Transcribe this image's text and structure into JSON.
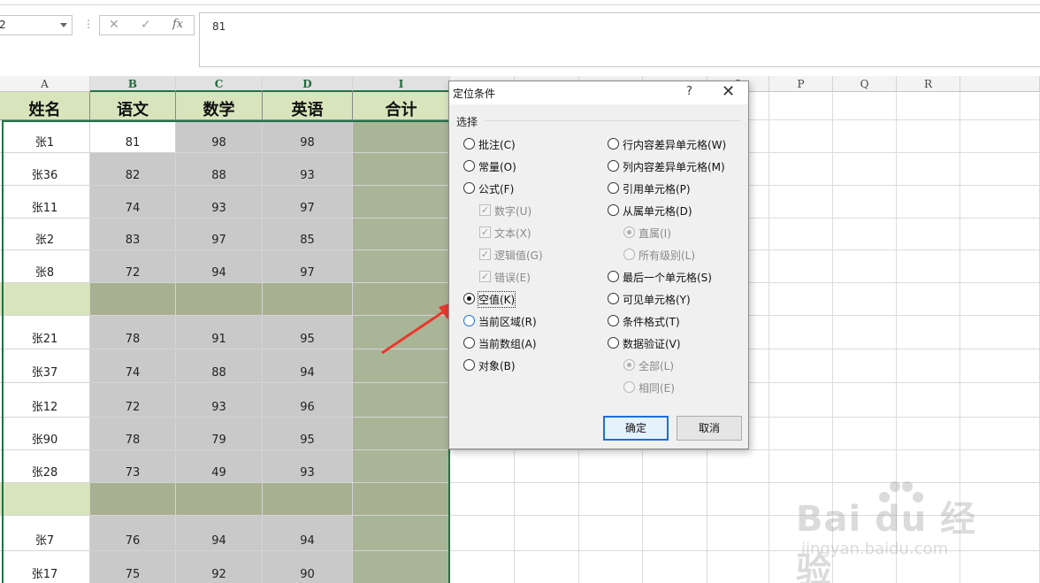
{
  "formula": {
    "namebox_value": "2",
    "cancel_icon": "✕",
    "enter_icon": "✓",
    "function_icon": "fx",
    "content": "81"
  },
  "columns": [
    {
      "letter": "A",
      "selected": false
    },
    {
      "letter": "B",
      "selected": true
    },
    {
      "letter": "C",
      "selected": true
    },
    {
      "letter": "D",
      "selected": true
    },
    {
      "letter": "I",
      "selected": true
    },
    {
      "letter": "",
      "selected": false
    },
    {
      "letter": "",
      "selected": false
    },
    {
      "letter": "",
      "selected": false
    },
    {
      "letter": "",
      "selected": false
    },
    {
      "letter": "O",
      "selected": false
    },
    {
      "letter": "P",
      "selected": false
    },
    {
      "letter": "Q",
      "selected": false
    },
    {
      "letter": "R",
      "selected": false
    }
  ],
  "table": {
    "headers": [
      "姓名",
      "语文",
      "数学",
      "英语",
      "合计"
    ],
    "rows": [
      {
        "name": "张1",
        "chinese": "81",
        "math": "98",
        "english": "98",
        "total": ""
      },
      {
        "name": "张36",
        "chinese": "82",
        "math": "88",
        "english": "93",
        "total": ""
      },
      {
        "name": "张11",
        "chinese": "74",
        "math": "93",
        "english": "97",
        "total": ""
      },
      {
        "name": "张2",
        "chinese": "83",
        "math": "97",
        "english": "85",
        "total": ""
      },
      {
        "name": "张8",
        "chinese": "72",
        "math": "94",
        "english": "97",
        "total": ""
      },
      {
        "name": "",
        "chinese": "",
        "math": "",
        "english": "",
        "total": ""
      },
      {
        "name": "张21",
        "chinese": "78",
        "math": "91",
        "english": "95",
        "total": ""
      },
      {
        "name": "张37",
        "chinese": "74",
        "math": "88",
        "english": "94",
        "total": ""
      },
      {
        "name": "张12",
        "chinese": "72",
        "math": "93",
        "english": "96",
        "total": ""
      },
      {
        "name": "张90",
        "chinese": "78",
        "math": "79",
        "english": "95",
        "total": ""
      },
      {
        "name": "张28",
        "chinese": "73",
        "math": "49",
        "english": "93",
        "total": ""
      },
      {
        "name": "",
        "chinese": "",
        "math": "",
        "english": "",
        "total": ""
      },
      {
        "name": "张7",
        "chinese": "76",
        "math": "94",
        "english": "94",
        "total": ""
      },
      {
        "name": "张17",
        "chinese": "75",
        "math": "92",
        "english": "90",
        "total": ""
      }
    ]
  },
  "dialog": {
    "title": "定位条件",
    "help": "?",
    "close": "✕",
    "group_label": "选择",
    "left_options": [
      {
        "label": "批注(C)",
        "kind": "radio",
        "checked": false,
        "disabled": false
      },
      {
        "label": "常量(O)",
        "kind": "radio",
        "checked": false,
        "disabled": false
      },
      {
        "label": "公式(F)",
        "kind": "radio",
        "checked": false,
        "disabled": false
      },
      {
        "label": "数字(U)",
        "kind": "check",
        "checked": true,
        "disabled": true
      },
      {
        "label": "文本(X)",
        "kind": "check",
        "checked": true,
        "disabled": true
      },
      {
        "label": "逻辑值(G)",
        "kind": "check",
        "checked": true,
        "disabled": true
      },
      {
        "label": "错误(E)",
        "kind": "check",
        "checked": true,
        "disabled": true
      },
      {
        "label": "空值(K)",
        "kind": "radio",
        "checked": true,
        "disabled": false
      },
      {
        "label": "当前区域(R)",
        "kind": "radio",
        "checked": false,
        "disabled": false
      },
      {
        "label": "当前数组(A)",
        "kind": "radio",
        "checked": false,
        "disabled": false
      },
      {
        "label": "对象(B)",
        "kind": "radio",
        "checked": false,
        "disabled": false
      }
    ],
    "right_options": [
      {
        "label": "行内容差异单元格(W)",
        "kind": "radio",
        "checked": false,
        "disabled": false
      },
      {
        "label": "列内容差异单元格(M)",
        "kind": "radio",
        "checked": false,
        "disabled": false
      },
      {
        "label": "引用单元格(P)",
        "kind": "radio",
        "checked": false,
        "disabled": false
      },
      {
        "label": "从属单元格(D)",
        "kind": "radio",
        "checked": false,
        "disabled": false
      },
      {
        "label": "直属(I)",
        "kind": "radio",
        "checked": true,
        "disabled": true
      },
      {
        "label": "所有级别(L)",
        "kind": "radio",
        "checked": false,
        "disabled": true
      },
      {
        "label": "最后一个单元格(S)",
        "kind": "radio",
        "checked": false,
        "disabled": false
      },
      {
        "label": "可见单元格(Y)",
        "kind": "radio",
        "checked": false,
        "disabled": false
      },
      {
        "label": "条件格式(T)",
        "kind": "radio",
        "checked": false,
        "disabled": false
      },
      {
        "label": "数据验证(V)",
        "kind": "radio",
        "checked": false,
        "disabled": false
      },
      {
        "label": "全部(L)",
        "kind": "radio",
        "checked": true,
        "disabled": true
      },
      {
        "label": "相同(E)",
        "kind": "radio",
        "checked": false,
        "disabled": true
      }
    ],
    "ok_label": "确定",
    "cancel_label": "取消"
  },
  "watermark": {
    "brand": "Bai du 经验",
    "url": "jingyan.baidu.com"
  },
  "colors": {
    "header_green": "#d8e4bc",
    "selected_gray": "#c9c9c9",
    "selected_olive": "#a9b597",
    "excel_green": "#217346",
    "arrow_red": "#e8382f"
  }
}
